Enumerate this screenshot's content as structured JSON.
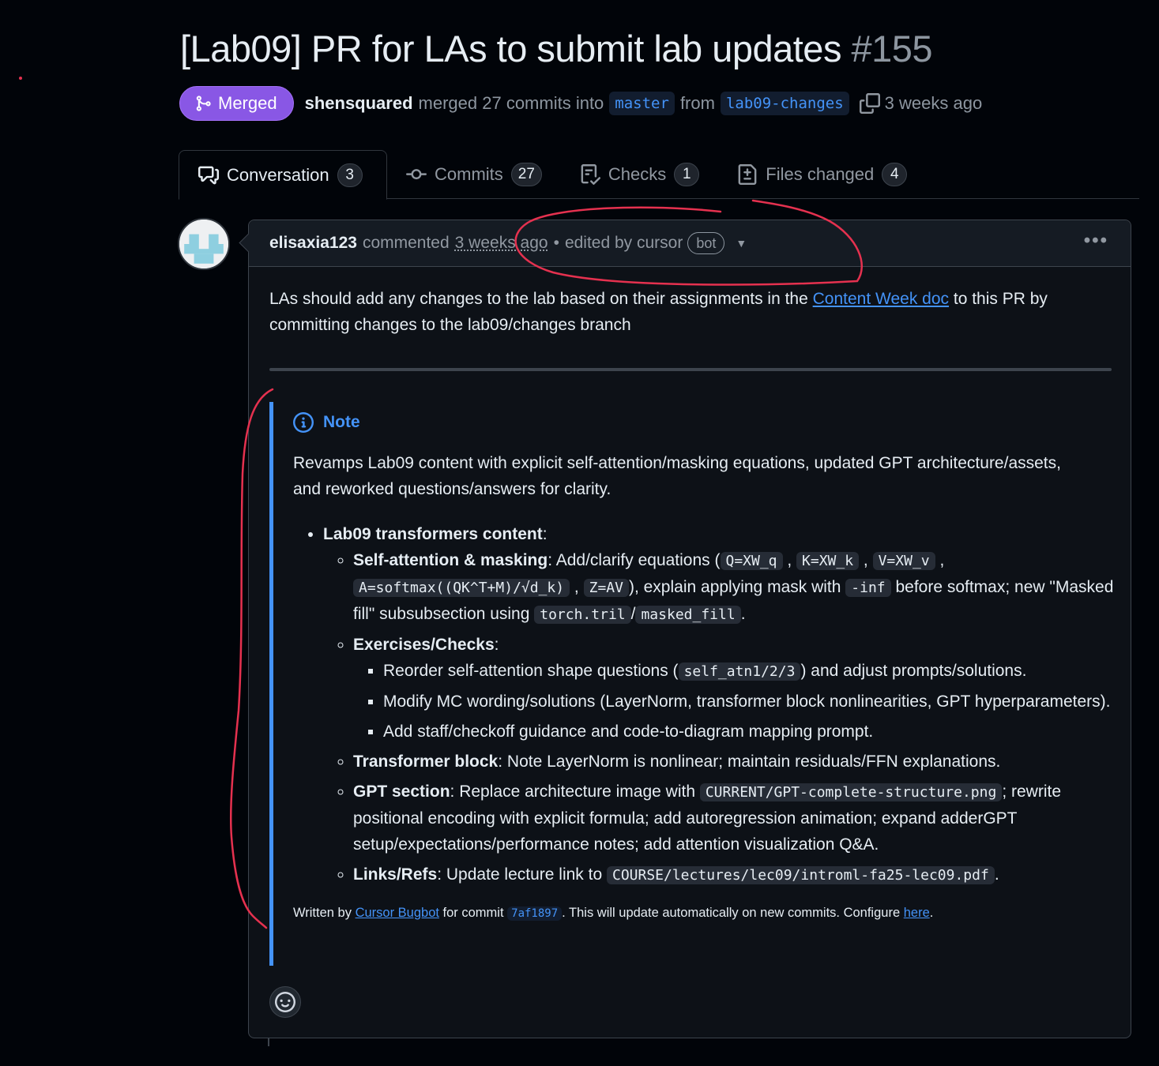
{
  "pr": {
    "title": "[Lab09] PR for LAs to submit lab updates",
    "number": "#155",
    "state": "Merged",
    "author": "shensquared",
    "action": "merged 27 commits into",
    "base_branch": "master",
    "from_word": "from",
    "head_branch": "lab09-changes",
    "time": "3 weeks ago"
  },
  "tabs": [
    {
      "label": "Conversation",
      "count": "3",
      "icon": "comment-discussion-icon"
    },
    {
      "label": "Commits",
      "count": "27",
      "icon": "git-commit-icon"
    },
    {
      "label": "Checks",
      "count": "1",
      "icon": "checklist-icon"
    },
    {
      "label": "Files changed",
      "count": "4",
      "icon": "file-diff-icon"
    }
  ],
  "comment": {
    "author": "elisaxia123",
    "action": "commented",
    "time": "3 weeks ago",
    "bullet": "•",
    "edited_by": "edited by cursor",
    "bot_label": "bot",
    "more": "•••",
    "intro_before": "LAs should add any changes to the lab based on their assignments in the ",
    "intro_link": "Content Week doc",
    "intro_after": " to this PR by committing changes to the lab09/changes branch"
  },
  "note": {
    "title": "Note",
    "summary": "Revamps Lab09 content with explicit self-attention/masking equations, updated GPT architecture/assets, and reworked questions/answers for clarity.",
    "section": "Lab09 transformers content",
    "self_attention_label": "Self-attention & masking",
    "sa_text1": ": Add/clarify equations (",
    "code_q": "Q=XW_q",
    "code_k": "K=XW_k",
    "code_v": "V=XW_v",
    "code_a": "A=softmax((QK^T+M)/√d_k)",
    "code_z": "Z=AV",
    "sa_text2": "), explain applying mask with ",
    "code_inf": "-inf",
    "sa_text3": " before softmax; new \"Masked fill\" subsubsection using ",
    "code_tril": "torch.tril",
    "sa_slash": "/",
    "code_masked": "masked_fill",
    "sa_end": ".",
    "exercises_label": "Exercises/Checks",
    "ex1_a": "Reorder self-attention shape questions (",
    "code_selfatn": "self_atn1/2/3",
    "ex1_b": ") and adjust prompts/solutions.",
    "ex2": "Modify MC wording/solutions (LayerNorm, transformer block nonlinearities, GPT hyperparameters).",
    "ex3": "Add staff/checkoff guidance and code-to-diagram mapping prompt.",
    "tb_label": "Transformer block",
    "tb_text": ": Note LayerNorm is nonlinear; maintain residuals/FFN explanations.",
    "gpt_label": "GPT section",
    "gpt_a": ": Replace architecture image with ",
    "code_gpt": "CURRENT/GPT-complete-structure.png",
    "gpt_b": "; rewrite positional encoding with explicit formula; add autoregression animation; expand adderGPT setup/expectations/performance notes; add attention visualization Q&A.",
    "links_label": "Links/Refs",
    "links_a": ": Update lecture link to ",
    "code_pdf": "COURSE/lectures/lec09/introml-fa25-lec09.pdf",
    "links_end": ".",
    "footer_a": "Written by ",
    "footer_link1": "Cursor Bugbot",
    "footer_b": " for commit ",
    "footer_commit": "7af1897",
    "footer_c": ". This will update automatically on new commits. Configure ",
    "footer_link2": "here",
    "footer_end": "."
  },
  "colors": {
    "merged": "#8957e5",
    "link": "#4493f8",
    "annotation": "#e5314f"
  }
}
